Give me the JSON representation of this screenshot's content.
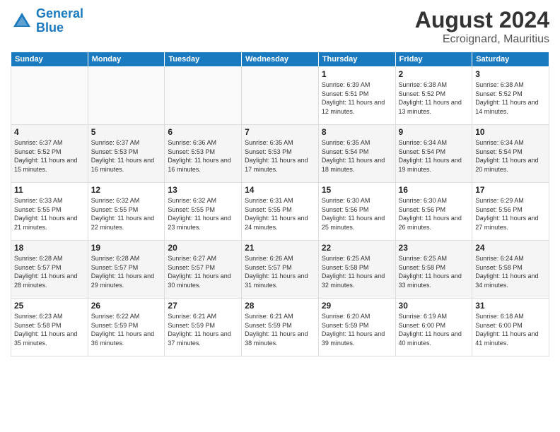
{
  "logo": {
    "line1": "General",
    "line2": "Blue"
  },
  "header": {
    "title": "August 2024",
    "location": "Ecroignard, Mauritius"
  },
  "weekdays": [
    "Sunday",
    "Monday",
    "Tuesday",
    "Wednesday",
    "Thursday",
    "Friday",
    "Saturday"
  ],
  "weeks": [
    [
      {
        "day": "",
        "sunrise": "",
        "sunset": "",
        "daylight": ""
      },
      {
        "day": "",
        "sunrise": "",
        "sunset": "",
        "daylight": ""
      },
      {
        "day": "",
        "sunrise": "",
        "sunset": "",
        "daylight": ""
      },
      {
        "day": "",
        "sunrise": "",
        "sunset": "",
        "daylight": ""
      },
      {
        "day": "1",
        "sunrise": "Sunrise: 6:39 AM",
        "sunset": "Sunset: 5:51 PM",
        "daylight": "Daylight: 11 hours and 12 minutes."
      },
      {
        "day": "2",
        "sunrise": "Sunrise: 6:38 AM",
        "sunset": "Sunset: 5:52 PM",
        "daylight": "Daylight: 11 hours and 13 minutes."
      },
      {
        "day": "3",
        "sunrise": "Sunrise: 6:38 AM",
        "sunset": "Sunset: 5:52 PM",
        "daylight": "Daylight: 11 hours and 14 minutes."
      }
    ],
    [
      {
        "day": "4",
        "sunrise": "Sunrise: 6:37 AM",
        "sunset": "Sunset: 5:52 PM",
        "daylight": "Daylight: 11 hours and 15 minutes."
      },
      {
        "day": "5",
        "sunrise": "Sunrise: 6:37 AM",
        "sunset": "Sunset: 5:53 PM",
        "daylight": "Daylight: 11 hours and 16 minutes."
      },
      {
        "day": "6",
        "sunrise": "Sunrise: 6:36 AM",
        "sunset": "Sunset: 5:53 PM",
        "daylight": "Daylight: 11 hours and 16 minutes."
      },
      {
        "day": "7",
        "sunrise": "Sunrise: 6:35 AM",
        "sunset": "Sunset: 5:53 PM",
        "daylight": "Daylight: 11 hours and 17 minutes."
      },
      {
        "day": "8",
        "sunrise": "Sunrise: 6:35 AM",
        "sunset": "Sunset: 5:54 PM",
        "daylight": "Daylight: 11 hours and 18 minutes."
      },
      {
        "day": "9",
        "sunrise": "Sunrise: 6:34 AM",
        "sunset": "Sunset: 5:54 PM",
        "daylight": "Daylight: 11 hours and 19 minutes."
      },
      {
        "day": "10",
        "sunrise": "Sunrise: 6:34 AM",
        "sunset": "Sunset: 5:54 PM",
        "daylight": "Daylight: 11 hours and 20 minutes."
      }
    ],
    [
      {
        "day": "11",
        "sunrise": "Sunrise: 6:33 AM",
        "sunset": "Sunset: 5:55 PM",
        "daylight": "Daylight: 11 hours and 21 minutes."
      },
      {
        "day": "12",
        "sunrise": "Sunrise: 6:32 AM",
        "sunset": "Sunset: 5:55 PM",
        "daylight": "Daylight: 11 hours and 22 minutes."
      },
      {
        "day": "13",
        "sunrise": "Sunrise: 6:32 AM",
        "sunset": "Sunset: 5:55 PM",
        "daylight": "Daylight: 11 hours and 23 minutes."
      },
      {
        "day": "14",
        "sunrise": "Sunrise: 6:31 AM",
        "sunset": "Sunset: 5:55 PM",
        "daylight": "Daylight: 11 hours and 24 minutes."
      },
      {
        "day": "15",
        "sunrise": "Sunrise: 6:30 AM",
        "sunset": "Sunset: 5:56 PM",
        "daylight": "Daylight: 11 hours and 25 minutes."
      },
      {
        "day": "16",
        "sunrise": "Sunrise: 6:30 AM",
        "sunset": "Sunset: 5:56 PM",
        "daylight": "Daylight: 11 hours and 26 minutes."
      },
      {
        "day": "17",
        "sunrise": "Sunrise: 6:29 AM",
        "sunset": "Sunset: 5:56 PM",
        "daylight": "Daylight: 11 hours and 27 minutes."
      }
    ],
    [
      {
        "day": "18",
        "sunrise": "Sunrise: 6:28 AM",
        "sunset": "Sunset: 5:57 PM",
        "daylight": "Daylight: 11 hours and 28 minutes."
      },
      {
        "day": "19",
        "sunrise": "Sunrise: 6:28 AM",
        "sunset": "Sunset: 5:57 PM",
        "daylight": "Daylight: 11 hours and 29 minutes."
      },
      {
        "day": "20",
        "sunrise": "Sunrise: 6:27 AM",
        "sunset": "Sunset: 5:57 PM",
        "daylight": "Daylight: 11 hours and 30 minutes."
      },
      {
        "day": "21",
        "sunrise": "Sunrise: 6:26 AM",
        "sunset": "Sunset: 5:57 PM",
        "daylight": "Daylight: 11 hours and 31 minutes."
      },
      {
        "day": "22",
        "sunrise": "Sunrise: 6:25 AM",
        "sunset": "Sunset: 5:58 PM",
        "daylight": "Daylight: 11 hours and 32 minutes."
      },
      {
        "day": "23",
        "sunrise": "Sunrise: 6:25 AM",
        "sunset": "Sunset: 5:58 PM",
        "daylight": "Daylight: 11 hours and 33 minutes."
      },
      {
        "day": "24",
        "sunrise": "Sunrise: 6:24 AM",
        "sunset": "Sunset: 5:58 PM",
        "daylight": "Daylight: 11 hours and 34 minutes."
      }
    ],
    [
      {
        "day": "25",
        "sunrise": "Sunrise: 6:23 AM",
        "sunset": "Sunset: 5:58 PM",
        "daylight": "Daylight: 11 hours and 35 minutes."
      },
      {
        "day": "26",
        "sunrise": "Sunrise: 6:22 AM",
        "sunset": "Sunset: 5:59 PM",
        "daylight": "Daylight: 11 hours and 36 minutes."
      },
      {
        "day": "27",
        "sunrise": "Sunrise: 6:21 AM",
        "sunset": "Sunset: 5:59 PM",
        "daylight": "Daylight: 11 hours and 37 minutes."
      },
      {
        "day": "28",
        "sunrise": "Sunrise: 6:21 AM",
        "sunset": "Sunset: 5:59 PM",
        "daylight": "Daylight: 11 hours and 38 minutes."
      },
      {
        "day": "29",
        "sunrise": "Sunrise: 6:20 AM",
        "sunset": "Sunset: 5:59 PM",
        "daylight": "Daylight: 11 hours and 39 minutes."
      },
      {
        "day": "30",
        "sunrise": "Sunrise: 6:19 AM",
        "sunset": "Sunset: 6:00 PM",
        "daylight": "Daylight: 11 hours and 40 minutes."
      },
      {
        "day": "31",
        "sunrise": "Sunrise: 6:18 AM",
        "sunset": "Sunset: 6:00 PM",
        "daylight": "Daylight: 11 hours and 41 minutes."
      }
    ]
  ]
}
